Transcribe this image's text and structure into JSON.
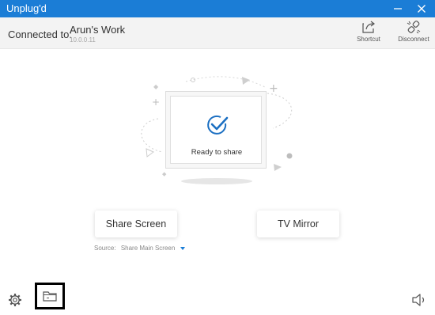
{
  "app": {
    "title": "Unplug'd"
  },
  "header": {
    "connected_label": "Connected to:",
    "device_name": "Arun's Work",
    "device_ip": "10.0.0.11",
    "shortcut_label": "Shortcut",
    "disconnect_label": "Disconnect"
  },
  "preview": {
    "status": "Ready to share"
  },
  "actions": {
    "share_screen": "Share Screen",
    "tv_mirror": "TV Mirror"
  },
  "source": {
    "label": "Source:",
    "value": "Share Main Screen"
  },
  "colors": {
    "accent": "#1b7dd6",
    "check": "#1b6fc2"
  },
  "icons": [
    "minimize-icon",
    "close-icon",
    "shortcut-icon",
    "disconnect-icon",
    "checkmark-icon",
    "settings-gear-icon",
    "folder-icon",
    "speaker-icon"
  ]
}
